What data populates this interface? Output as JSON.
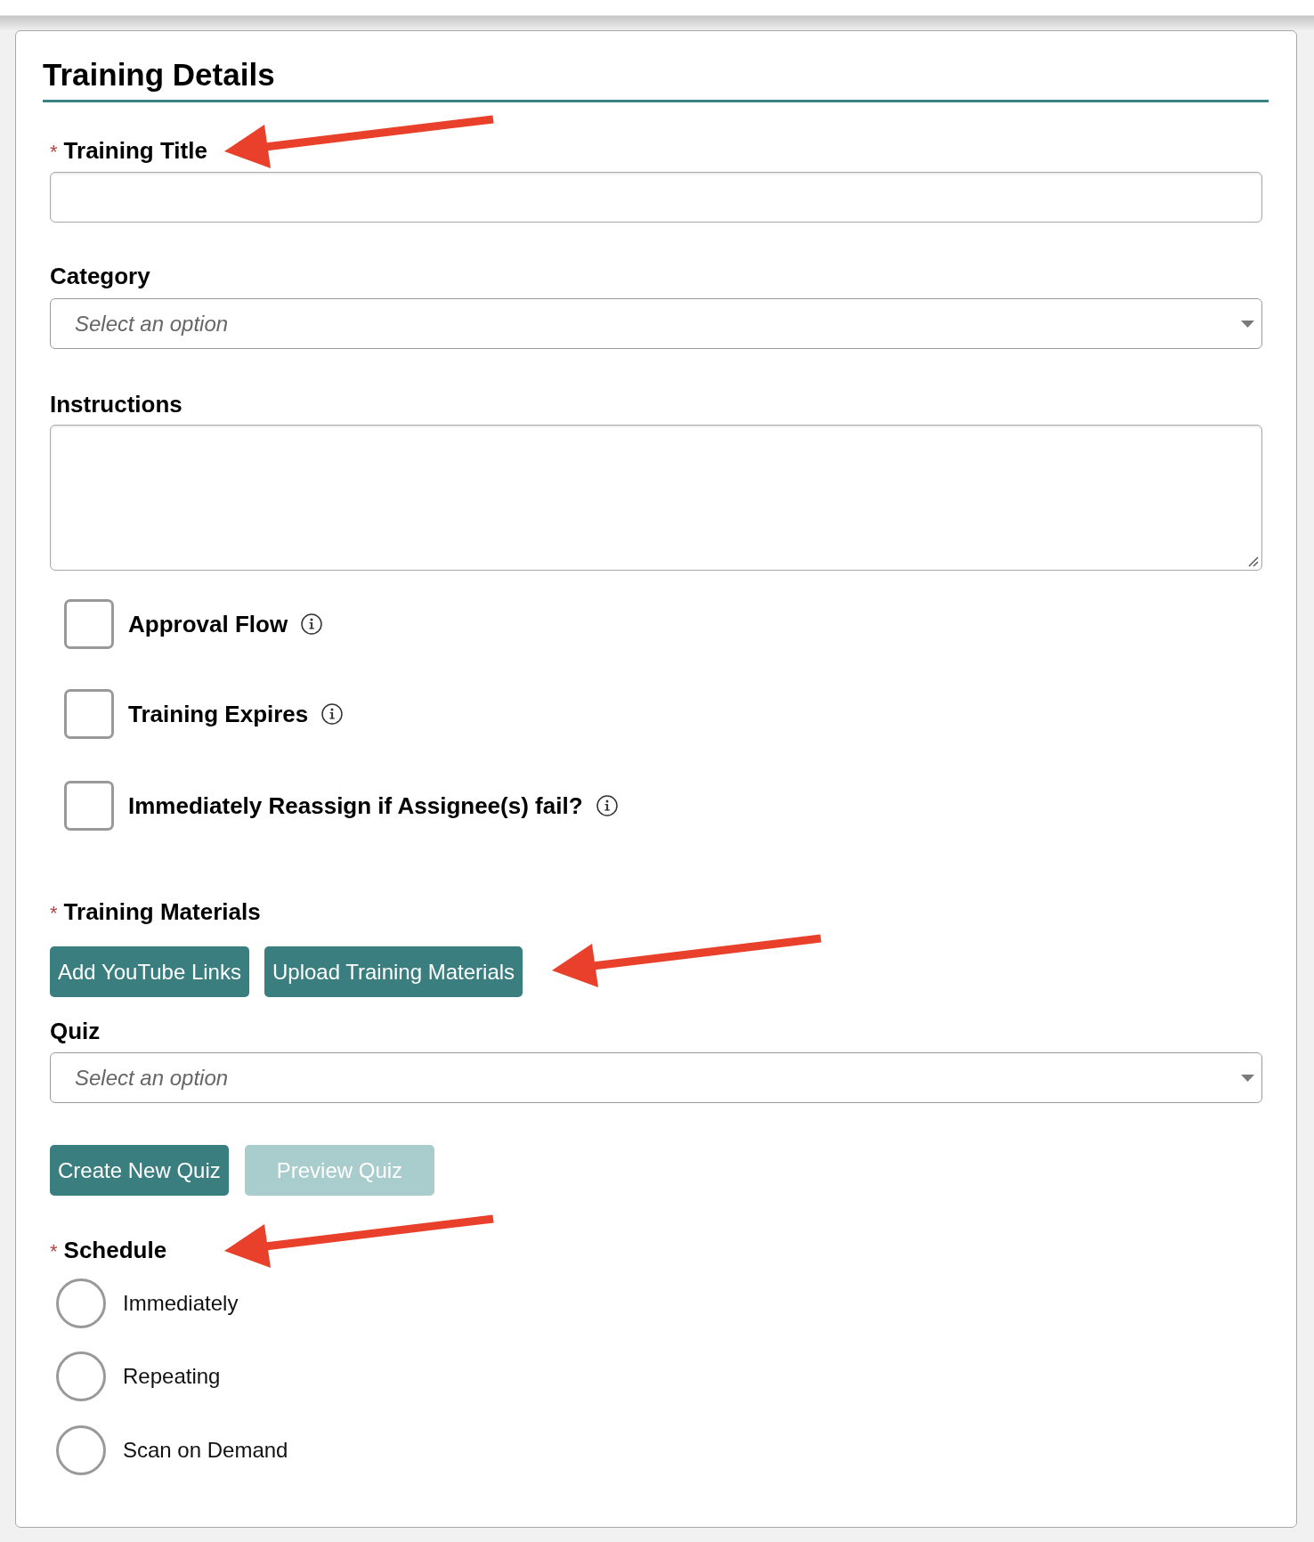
{
  "heading": "Training Details",
  "training_title": {
    "label": "Training Title",
    "required_mark": "*",
    "arrow": true
  },
  "category": {
    "label": "Category",
    "placeholder": "Select an option"
  },
  "instructions": {
    "label": "Instructions"
  },
  "options": [
    {
      "label": "Approval Flow",
      "checked": false
    },
    {
      "label": "Training Expires",
      "checked": false
    },
    {
      "label": "Immediately Reassign if Assignee(s) fail?",
      "checked": false
    }
  ],
  "training_materials": {
    "label": "Training Materials",
    "required_mark": "*",
    "arrow": true,
    "buttons": [
      {
        "label": "Add YouTube Links",
        "disabled": false
      },
      {
        "label": "Upload Training Materials",
        "disabled": false
      }
    ]
  },
  "quiz": {
    "label": "Quiz",
    "placeholder": "Select an option",
    "buttons": [
      {
        "label": "Create New Quiz",
        "disabled": false
      },
      {
        "label": "Preview Quiz",
        "disabled": true
      }
    ]
  },
  "schedule": {
    "label": "Schedule",
    "required_mark": "*",
    "arrow": true,
    "options": [
      {
        "label": "Immediately",
        "selected": false
      },
      {
        "label": "Repeating",
        "selected": false
      },
      {
        "label": "Scan on Demand",
        "selected": false
      }
    ]
  }
}
